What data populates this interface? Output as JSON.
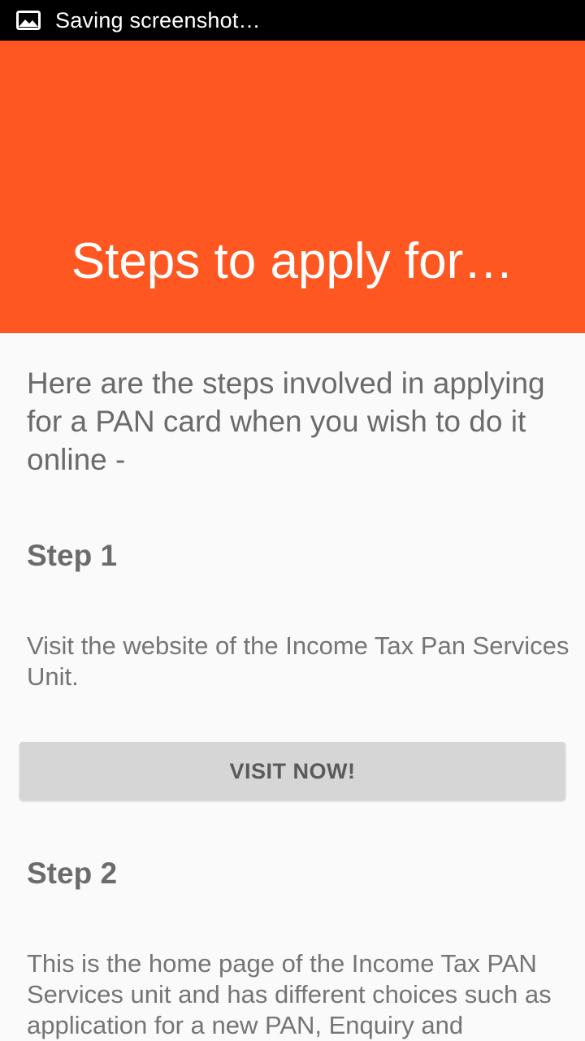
{
  "status_bar": {
    "icon": "image-icon",
    "text": "Saving screenshot…"
  },
  "header": {
    "title": "Steps to apply for…",
    "background_color": "#ff5722"
  },
  "content": {
    "intro": "Here are the steps involved in applying for a PAN card when you wish to do it online -",
    "steps": [
      {
        "heading": "Step 1",
        "text": "Visit the website of the Income Tax Pan Services Unit.",
        "button_label": "VISIT NOW!"
      },
      {
        "heading": "Step 2",
        "text": "This is the home page of the Income Tax PAN Services unit and has different choices such as application for a new PAN, Enquiry and"
      }
    ]
  }
}
